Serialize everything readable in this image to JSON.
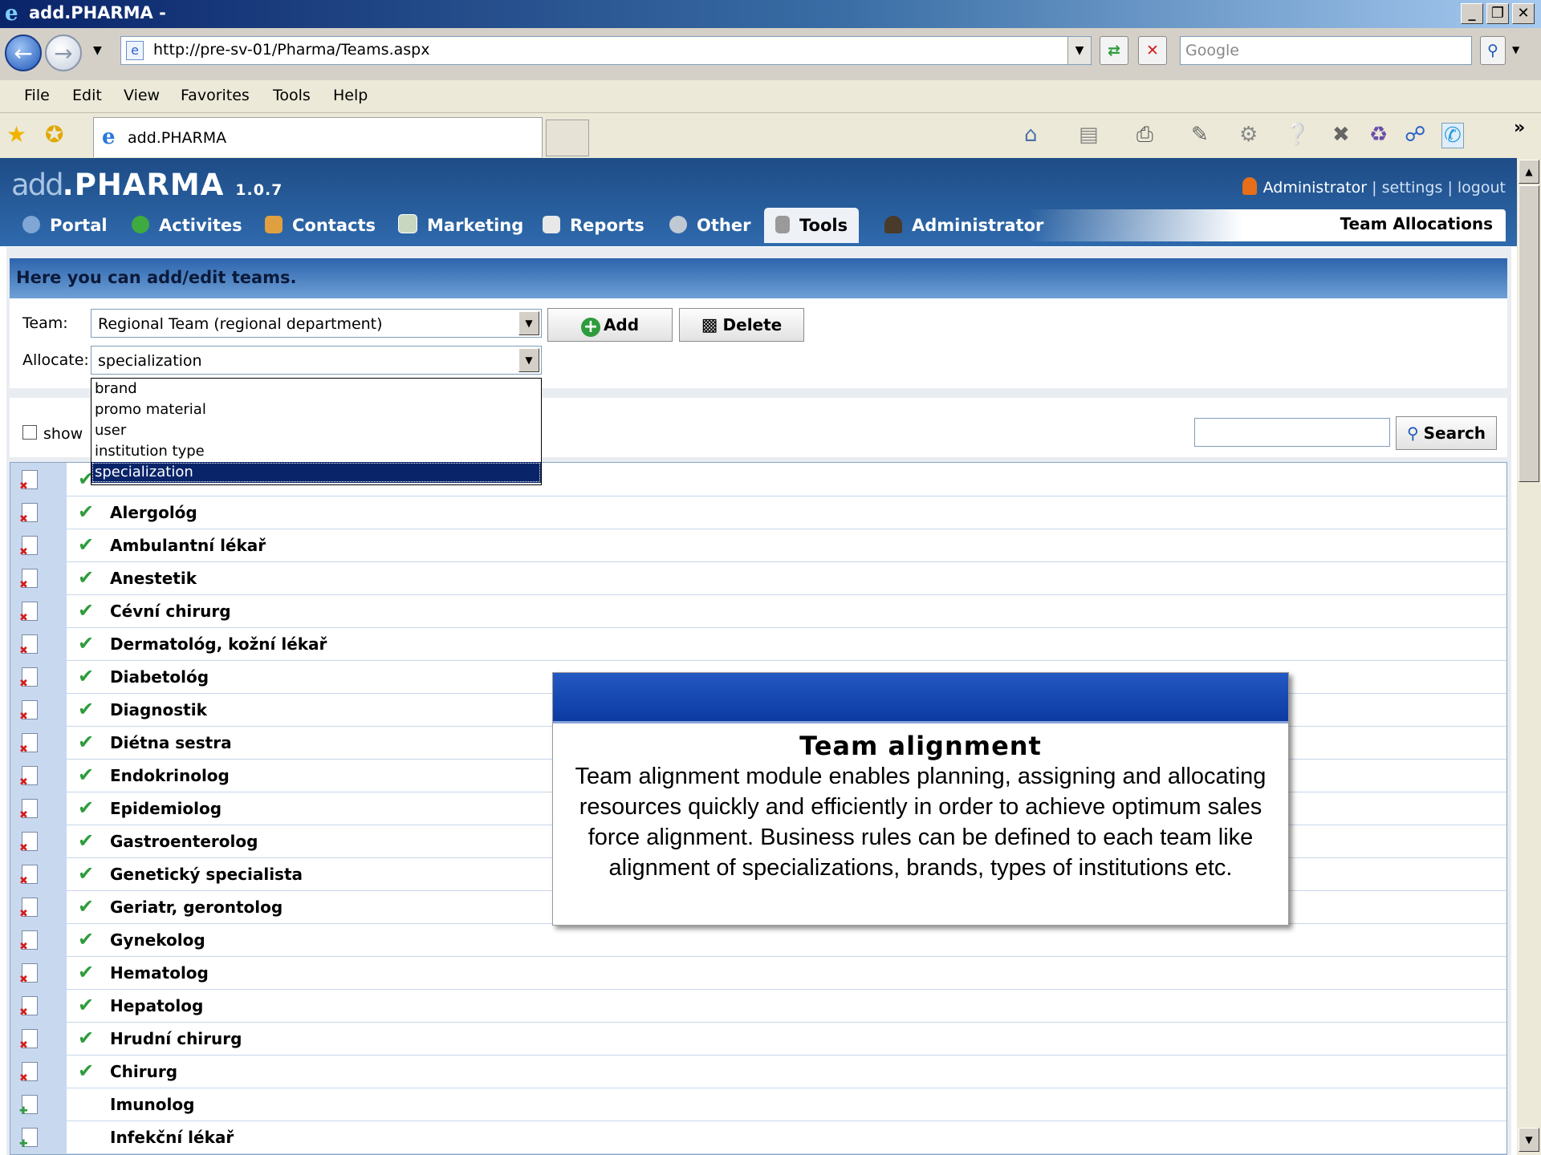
{
  "browser": {
    "window_title": "add.PHARMA -",
    "url": "http://pre-sv-01/Pharma/Teams.aspx",
    "search_placeholder": "Google",
    "menu": [
      "File",
      "Edit",
      "View",
      "Favorites",
      "Tools",
      "Help"
    ],
    "tab_title": "add.PHARMA",
    "chevron": "»"
  },
  "app": {
    "logo_add": "add",
    "logo_pharma": ".PHARMA",
    "version": "1.0.7",
    "user": "Administrator",
    "settings": "settings",
    "logout": "logout",
    "separator": "|",
    "nav_tabs": [
      "Portal",
      "Activites",
      "Contacts",
      "Marketing",
      "Reports",
      "Other",
      "Tools",
      "Administrator"
    ],
    "active_tab": "Tools",
    "page_label": "Team Allocations"
  },
  "content": {
    "info": "Here you can add/edit teams.",
    "team_label": "Team:",
    "team_value": "Regional Team (regional department)",
    "allocate_label": "Allocate:",
    "allocate_value": "specialization",
    "add_button": "Add",
    "delete_button": "Delete",
    "dropdown_options": [
      "brand",
      "promo material",
      "user",
      "institution type",
      "specialization"
    ],
    "selected_option": "specialization",
    "show_label": "show",
    "search_button": "Search"
  },
  "list": [
    {
      "name": "",
      "checked": true
    },
    {
      "name": "Alergológ",
      "checked": true
    },
    {
      "name": "Ambulantní lékař",
      "checked": true
    },
    {
      "name": "Anestetik",
      "checked": true
    },
    {
      "name": "Cévní chirurg",
      "checked": true
    },
    {
      "name": "Dermatológ, kožní lékař",
      "checked": true
    },
    {
      "name": "Diabetológ",
      "checked": true
    },
    {
      "name": "Diagnostik",
      "checked": true
    },
    {
      "name": "Diétna sestra",
      "checked": true
    },
    {
      "name": "Endokrinolog",
      "checked": true
    },
    {
      "name": "Epidemiolog",
      "checked": true
    },
    {
      "name": "Gastroenterolog",
      "checked": true
    },
    {
      "name": "Genetický specialista",
      "checked": true
    },
    {
      "name": "Geriatr, gerontolog",
      "checked": true
    },
    {
      "name": "Gynekolog",
      "checked": true
    },
    {
      "name": "Hematolog",
      "checked": true
    },
    {
      "name": "Hepatolog",
      "checked": true
    },
    {
      "name": "Hrudní chirurg",
      "checked": true
    },
    {
      "name": "Chirurg",
      "checked": true
    },
    {
      "name": "Imunolog",
      "checked": false
    },
    {
      "name": "Infekční lékař",
      "checked": false
    }
  ],
  "callout": {
    "title": "Team alignment",
    "body": "Team alignment module enables planning, assigning and allocating resources quickly and efficiently in order to achieve optimum sales force alignment. Business rules can be defined to each team like alignment of specializations, brands, types of institutions etc."
  },
  "colors": {
    "header_blue": "#2f6aad",
    "check_green": "#2e9c3c",
    "remove_red": "#d21f1f",
    "selection": "#0a246a"
  },
  "icons": {
    "nav": [
      "globe-icon",
      "refresh-circle-icon",
      "contacts-icon",
      "chart-icon",
      "report-icon",
      "gear-icon",
      "wrench-icon",
      "admin-icon"
    ],
    "row_checked": "remove-doc-icon",
    "row_unchecked": "add-doc-icon"
  }
}
